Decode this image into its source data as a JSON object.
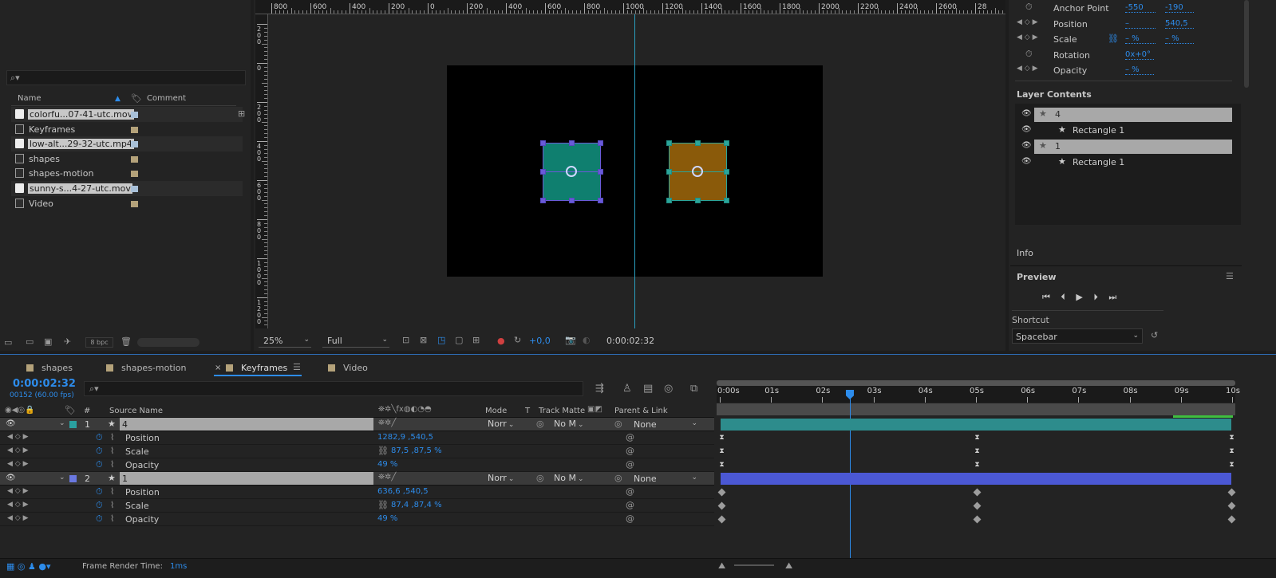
{
  "colors": {
    "accent": "#2d8ceb",
    "teal_layer": "#20948a",
    "orange_layer": "#8a5a0a",
    "purple_bar": "#4b58d4",
    "teal_bar": "#2d8c8c"
  },
  "ruler": {
    "labels": [
      "800",
      "600",
      "400",
      "200",
      "0",
      "200",
      "400",
      "600",
      "800",
      "1000",
      "1200",
      "1400",
      "1600",
      "1800",
      "2000",
      "2200",
      "2400",
      "2600",
      "28"
    ]
  },
  "vruler": {
    "labels": [
      "200",
      "0",
      "200",
      "400",
      "600",
      "800",
      "1000",
      "1200"
    ]
  },
  "project": {
    "search_placeholder": "",
    "columns": {
      "name": "Name",
      "comment": "Comment"
    },
    "items": [
      {
        "label": "colorfu...07-41-utc.mov",
        "type": "footage",
        "selected": true,
        "swatch": "#a8c0d8"
      },
      {
        "label": "Keyframes",
        "type": "comp",
        "selected": false,
        "swatch": "#b4a27a"
      },
      {
        "label": "low-alt...29-32-utc.mp4",
        "type": "footage",
        "selected": true,
        "swatch": "#a8c0d8"
      },
      {
        "label": "shapes",
        "type": "comp",
        "selected": false,
        "swatch": "#b4a27a"
      },
      {
        "label": "shapes-motion",
        "type": "comp",
        "selected": false,
        "swatch": "#b4a27a"
      },
      {
        "label": "sunny-s...4-27-utc.mov",
        "type": "footage",
        "selected": true,
        "swatch": "#a8c0d8"
      },
      {
        "label": "Video",
        "type": "comp",
        "selected": false,
        "swatch": "#b4a27a"
      }
    ],
    "bpc": "8 bpc"
  },
  "viewer": {
    "zoom": "25%",
    "resolution": "Full",
    "exposure": "+0,0",
    "timecode": "0:00:02:32"
  },
  "properties": {
    "anchor": {
      "label": "Anchor Point",
      "x": "-550",
      "y": "-190"
    },
    "position": {
      "label": "Position",
      "x": "–",
      "y": "540,5"
    },
    "scale": {
      "label": "Scale",
      "x": "– %",
      "y": "– %"
    },
    "rotation": {
      "label": "Rotation",
      "value": "0x+0°"
    },
    "opacity": {
      "label": "Opacity",
      "value": "– %"
    }
  },
  "layer_contents": {
    "title": "Layer Contents",
    "items": [
      {
        "label": "4",
        "type": "layer"
      },
      {
        "label": "Rectangle 1",
        "type": "shape"
      },
      {
        "label": "1",
        "type": "layer"
      },
      {
        "label": "Rectangle 1",
        "type": "shape"
      }
    ]
  },
  "info": {
    "title": "Info"
  },
  "preview": {
    "title": "Preview",
    "shortcut_label": "Shortcut",
    "shortcut_value": "Spacebar"
  },
  "tabs": [
    {
      "label": "shapes"
    },
    {
      "label": "shapes-motion"
    },
    {
      "label": "Keyframes",
      "active": true
    },
    {
      "label": "Video"
    }
  ],
  "timeline": {
    "timecode": "0:00:02:32",
    "frames": "00152 (60.00 fps)",
    "headers": {
      "num": "#",
      "source": "Source Name",
      "mode": "Mode",
      "t": "T",
      "matte": "Track Matte",
      "parent": "Parent & Link"
    },
    "ticks": [
      "0:00s",
      "01s",
      "02s",
      "03s",
      "04s",
      "05s",
      "06s",
      "07s",
      "08s",
      "09s",
      "10s"
    ],
    "layers": [
      {
        "num": "1",
        "name": "4",
        "mode": "Norr",
        "matte": "No M",
        "parent": "None",
        "color": "#2aa0a0",
        "props": [
          {
            "name": "Position",
            "value": "1282,9 ,540,5"
          },
          {
            "name": "Scale",
            "value": "87,5 ,87,5 %"
          },
          {
            "name": "Opacity",
            "value": "49 %"
          }
        ]
      },
      {
        "num": "2",
        "name": "1",
        "mode": "Norr",
        "matte": "No M",
        "parent": "None",
        "color": "#6a78e0",
        "props": [
          {
            "name": "Position",
            "value": "636,6 ,540,5"
          },
          {
            "name": "Scale",
            "value": "87,4 ,87,4 %"
          },
          {
            "name": "Opacity",
            "value": "49 %"
          }
        ]
      }
    ],
    "render_time_label": "Frame Render Time:",
    "render_time_value": "1ms"
  }
}
